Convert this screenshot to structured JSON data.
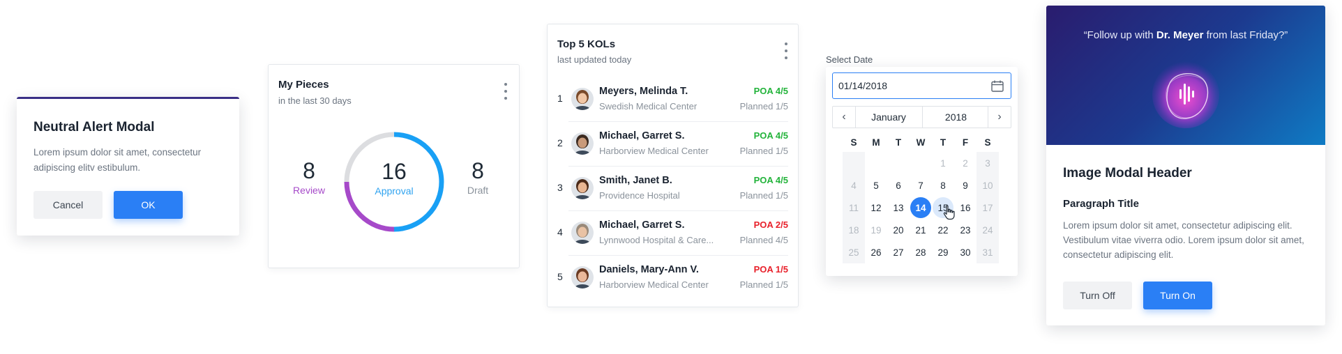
{
  "alert_modal": {
    "title": "Neutral Alert Modal",
    "body": "Lorem ipsum dolor sit amet, consectetur adipiscing elitv estibulum.",
    "cancel_label": "Cancel",
    "ok_label": "OK",
    "accent_color": "#3a2f86"
  },
  "my_pieces": {
    "title": "My Pieces",
    "subtitle": "in the last 30 days",
    "review": {
      "value": "8",
      "label": "Review",
      "color": "#a64ac9"
    },
    "approval": {
      "value": "16",
      "label": "Approval",
      "color": "#2fa3f0"
    },
    "draft": {
      "value": "8",
      "label": "Draft",
      "color": "#8a929b"
    },
    "donut_segments": [
      {
        "name": "Approval",
        "fraction": 0.5,
        "color": "#19a0f5"
      },
      {
        "name": "Review",
        "fraction": 0.25,
        "color": "#a64ac9"
      },
      {
        "name": "Draft",
        "fraction": 0.25,
        "color": "#dcdde0"
      }
    ]
  },
  "kols": {
    "title": "Top 5 KOLs",
    "subtitle": "last updated today",
    "rows": [
      {
        "rank": "1",
        "name": "Meyers, Melinda T.",
        "org": "Swedish Medical Center",
        "poa": "POA 4/5",
        "poa_status": "good",
        "planned": "Planned 1/5"
      },
      {
        "rank": "2",
        "name": "Michael, Garret S.",
        "org": "Harborview Medical Center",
        "poa": "POA 4/5",
        "poa_status": "good",
        "planned": "Planned 1/5"
      },
      {
        "rank": "3",
        "name": "Smith, Janet B.",
        "org": "Providence Hospital",
        "poa": "POA 4/5",
        "poa_status": "good",
        "planned": "Planned 1/5"
      },
      {
        "rank": "4",
        "name": "Michael, Garret S.",
        "org": "Lynnwood Hospital & Care...",
        "poa": "POA 2/5",
        "poa_status": "bad",
        "planned": "Planned 4/5"
      },
      {
        "rank": "5",
        "name": "Daniels, Mary-Ann V.",
        "org": "Harborview Medical Center",
        "poa": "POA 1/5",
        "poa_status": "bad",
        "planned": "Planned 1/5"
      }
    ],
    "good_color": "#22b33a",
    "bad_color": "#e8202a"
  },
  "date_picker": {
    "label": "Select Date",
    "value": "01/14/2018",
    "month": "January",
    "year": "2018",
    "weekdays": [
      "S",
      "M",
      "T",
      "W",
      "T",
      "F",
      "S"
    ],
    "weeks": [
      [
        {
          "d": ""
        },
        {
          "d": ""
        },
        {
          "d": ""
        },
        {
          "d": ""
        },
        {
          "d": "1",
          "out": true
        },
        {
          "d": "2",
          "out": true
        },
        {
          "d": "3",
          "out": true
        }
      ],
      [
        {
          "d": "4",
          "out": true
        },
        {
          "d": "5"
        },
        {
          "d": "6"
        },
        {
          "d": "7"
        },
        {
          "d": "8"
        },
        {
          "d": "9"
        },
        {
          "d": "10",
          "out": true
        }
      ],
      [
        {
          "d": "11",
          "out": true
        },
        {
          "d": "12"
        },
        {
          "d": "13"
        },
        {
          "d": "14",
          "selected": true
        },
        {
          "d": "15",
          "hover": true
        },
        {
          "d": "16"
        },
        {
          "d": "17",
          "out": true
        }
      ],
      [
        {
          "d": "18",
          "out": true
        },
        {
          "d": "19",
          "out": true
        },
        {
          "d": "20"
        },
        {
          "d": "21"
        },
        {
          "d": "22"
        },
        {
          "d": "23"
        },
        {
          "d": "24",
          "out": true
        }
      ],
      [
        {
          "d": "25",
          "out": true
        },
        {
          "d": "26"
        },
        {
          "d": "27"
        },
        {
          "d": "28"
        },
        {
          "d": "29"
        },
        {
          "d": "30"
        },
        {
          "d": "31",
          "out": true
        }
      ]
    ],
    "accent_color": "#2a7ff5"
  },
  "image_modal": {
    "quote_prefix": "“Follow up with ",
    "quote_name": "Dr. Meyer",
    "quote_suffix": " from last Friday?”",
    "header": "Image Modal Header",
    "paragraph_title": "Paragraph Title",
    "paragraph": "Lorem ipsum dolor sit amet, consectetur adipiscing elit. Vestibulum vitae viverra odio. Lorem ipsum dolor sit amet, consectetur adipiscing elit.",
    "off_label": "Turn Off",
    "on_label": "Turn On",
    "voice_icon": "voice-assistant-icon"
  }
}
